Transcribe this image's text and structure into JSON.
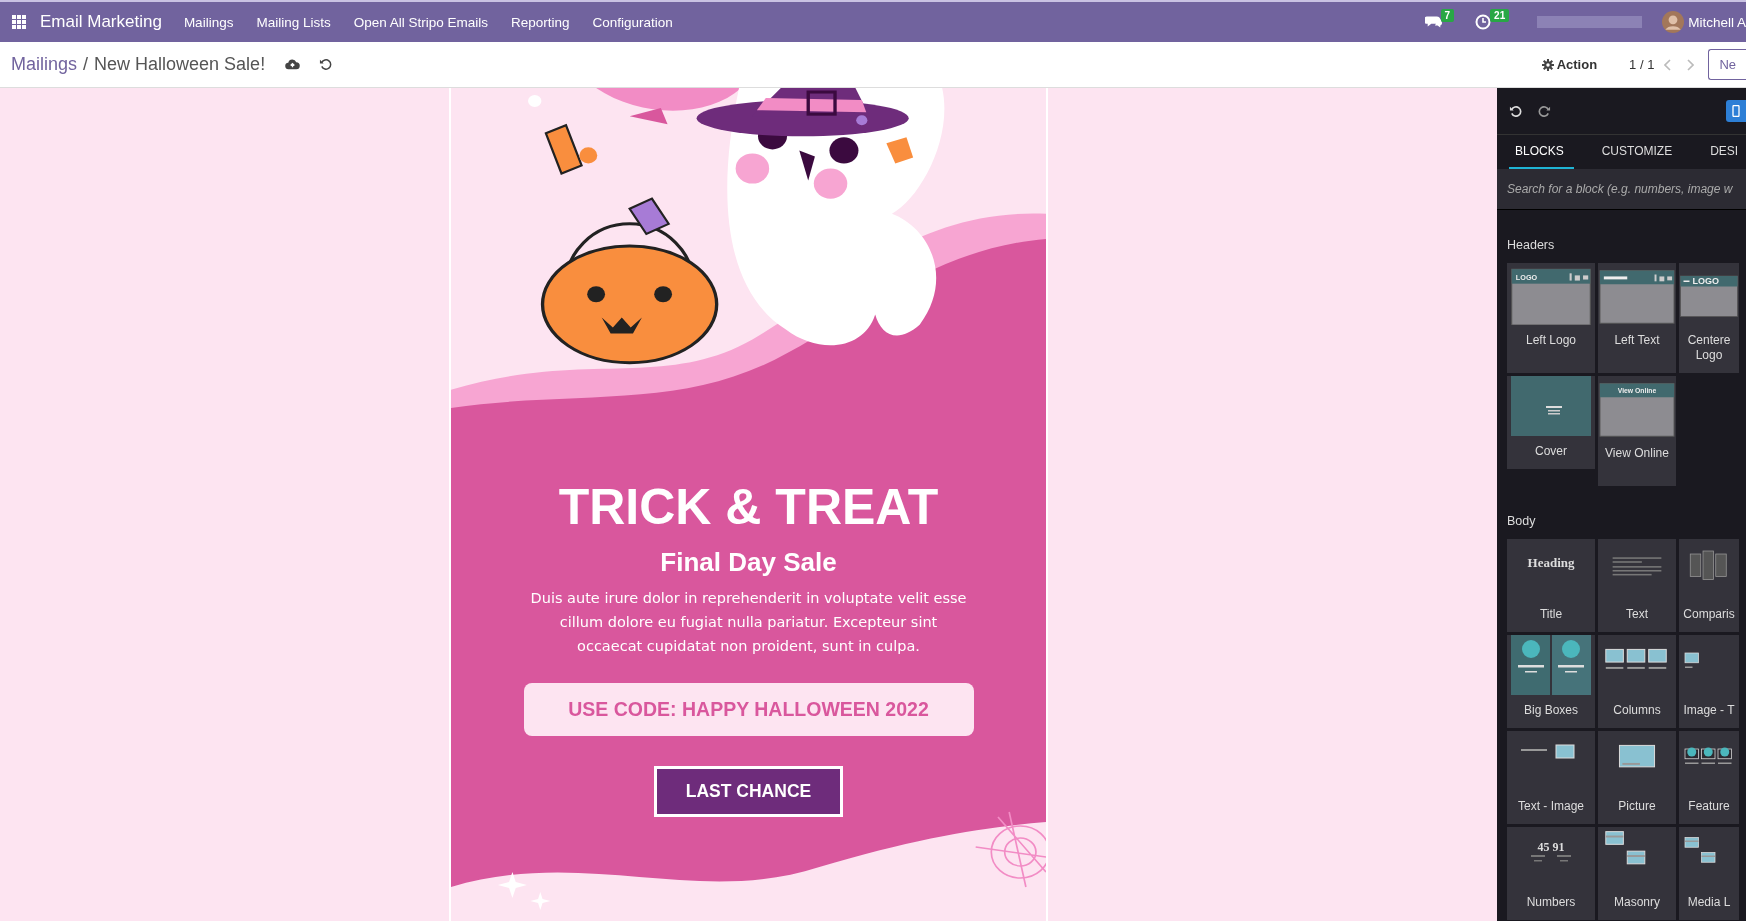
{
  "app_bar": {
    "app_name": "Email Marketing",
    "menu": [
      "Mailings",
      "Mailing Lists",
      "Open All Stripo Emails",
      "Reporting",
      "Configuration"
    ],
    "messages_count": "7",
    "activities_count": "21",
    "user_name": "Mitchell A"
  },
  "breadcrumb": {
    "parent": "Mailings",
    "separator": "/",
    "current": "New Halloween Sale!"
  },
  "control_panel": {
    "action_label": "Action",
    "pager": "1 / 1",
    "new_button": "Ne"
  },
  "email": {
    "title": "TRICK & TREAT",
    "subtitle": "Final Day Sale",
    "body": "Duis aute irure dolor in reprehenderit in voluptate velit esse cillum dolore eu fugiat nulla pariatur. Excepteur sint occaecat cupidatat non proident, sunt in culpa.",
    "code": "USE CODE: HAPPY HALLOWEEN 2022",
    "cta": "LAST CHANCE"
  },
  "editor_panel": {
    "tabs": [
      {
        "label": "BLOCKS",
        "selected": true
      },
      {
        "label": "CUSTOMIZE",
        "selected": false
      },
      {
        "label": "DESI",
        "selected": false
      }
    ],
    "search": {
      "placeholder": "Search for a block (e.g. numbers, image w"
    },
    "sections": [
      {
        "title": "Headers",
        "blocks": [
          {
            "kind": "left-logo",
            "label": "Left Logo",
            "preview_text": "LOGO"
          },
          {
            "kind": "left-text",
            "label": "Left Text"
          },
          {
            "kind": "centered-logo",
            "label": "Centere Logo",
            "preview_text": "LOGO"
          },
          {
            "kind": "cover",
            "label": "Cover"
          },
          {
            "kind": "view-online",
            "label": "View Online",
            "preview_text": "View Online"
          }
        ]
      },
      {
        "title": "Body",
        "blocks": [
          {
            "kind": "heading",
            "label": "Title",
            "preview_text": "Heading"
          },
          {
            "kind": "text",
            "label": "Text"
          },
          {
            "kind": "comparison",
            "label": "Comparis"
          },
          {
            "kind": "big-boxes",
            "label": "Big Boxes"
          },
          {
            "kind": "columns",
            "label": "Columns"
          },
          {
            "kind": "image-text",
            "label": "Image - T"
          },
          {
            "kind": "text-image",
            "label": "Text - Image"
          },
          {
            "kind": "picture",
            "label": "Picture"
          },
          {
            "kind": "features",
            "label": "Feature"
          },
          {
            "kind": "numbers",
            "label": "Numbers",
            "preview_text": "45 91"
          },
          {
            "kind": "masonry",
            "label": "Masonry"
          },
          {
            "kind": "media-list",
            "label": "Media L"
          }
        ]
      }
    ]
  }
}
